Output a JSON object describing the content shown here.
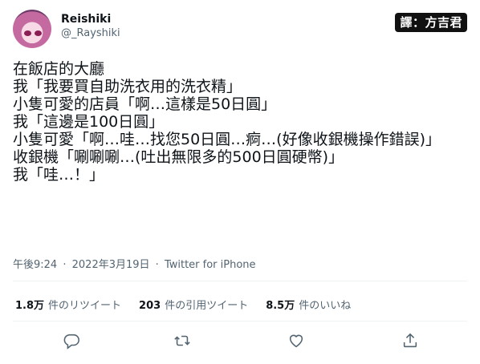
{
  "author": {
    "display_name": "Reishiki",
    "handle": "@_Rayshiki"
  },
  "translator_badge": "譯：方吉君",
  "tweet": {
    "text": "在飯店的大廳\n我「我要買自助洗衣用的洗衣精」\n小隻可愛的店員「啊…這樣是50日圓」\n我「這邊是100日圓」\n小隻可愛「啊…哇…找您50日圓…痾…(好像收銀機操作錯誤)」\n收銀機「唰唰唰…(吐出無限多的500日圓硬幣)」\n我「哇…！」"
  },
  "meta": {
    "time": "午後9:24",
    "date": "2022年3月19日",
    "separator": "·",
    "source": "Twitter for iPhone"
  },
  "stats": [
    {
      "count": "1.8万",
      "label": "件のリツイート"
    },
    {
      "count": "203",
      "label": "件の引用ツイート"
    },
    {
      "count": "8.5万",
      "label": "件のいいね"
    }
  ],
  "actions": [
    "reply-icon",
    "retweet-icon",
    "like-icon",
    "share-icon"
  ]
}
